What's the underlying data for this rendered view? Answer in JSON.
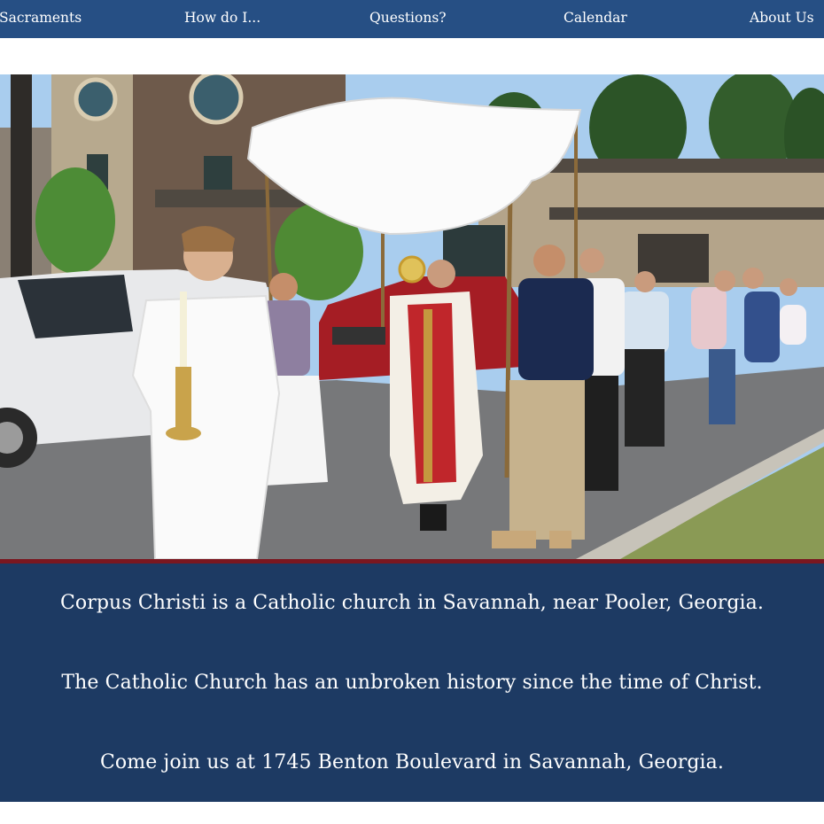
{
  "nav": {
    "items": [
      {
        "label": "Sacraments"
      },
      {
        "label": "How do I..."
      },
      {
        "label": "Questions?"
      },
      {
        "label": "Calendar"
      },
      {
        "label": "About Us"
      }
    ]
  },
  "hero": {
    "photo": "eucharistic-procession-photo"
  },
  "info": {
    "line1": "Corpus Christi is a Catholic church in Savannah, near Pooler, Georgia.",
    "line2": "The Catholic Church has an unbroken history since the time of Christ.",
    "line3": "Come join us at 1745 Benton Boulevard in Savannah, Georgia."
  },
  "colors": {
    "nav_bg": "#264f84",
    "info_bg": "#1d3a63",
    "accent_red": "#7a1720"
  }
}
